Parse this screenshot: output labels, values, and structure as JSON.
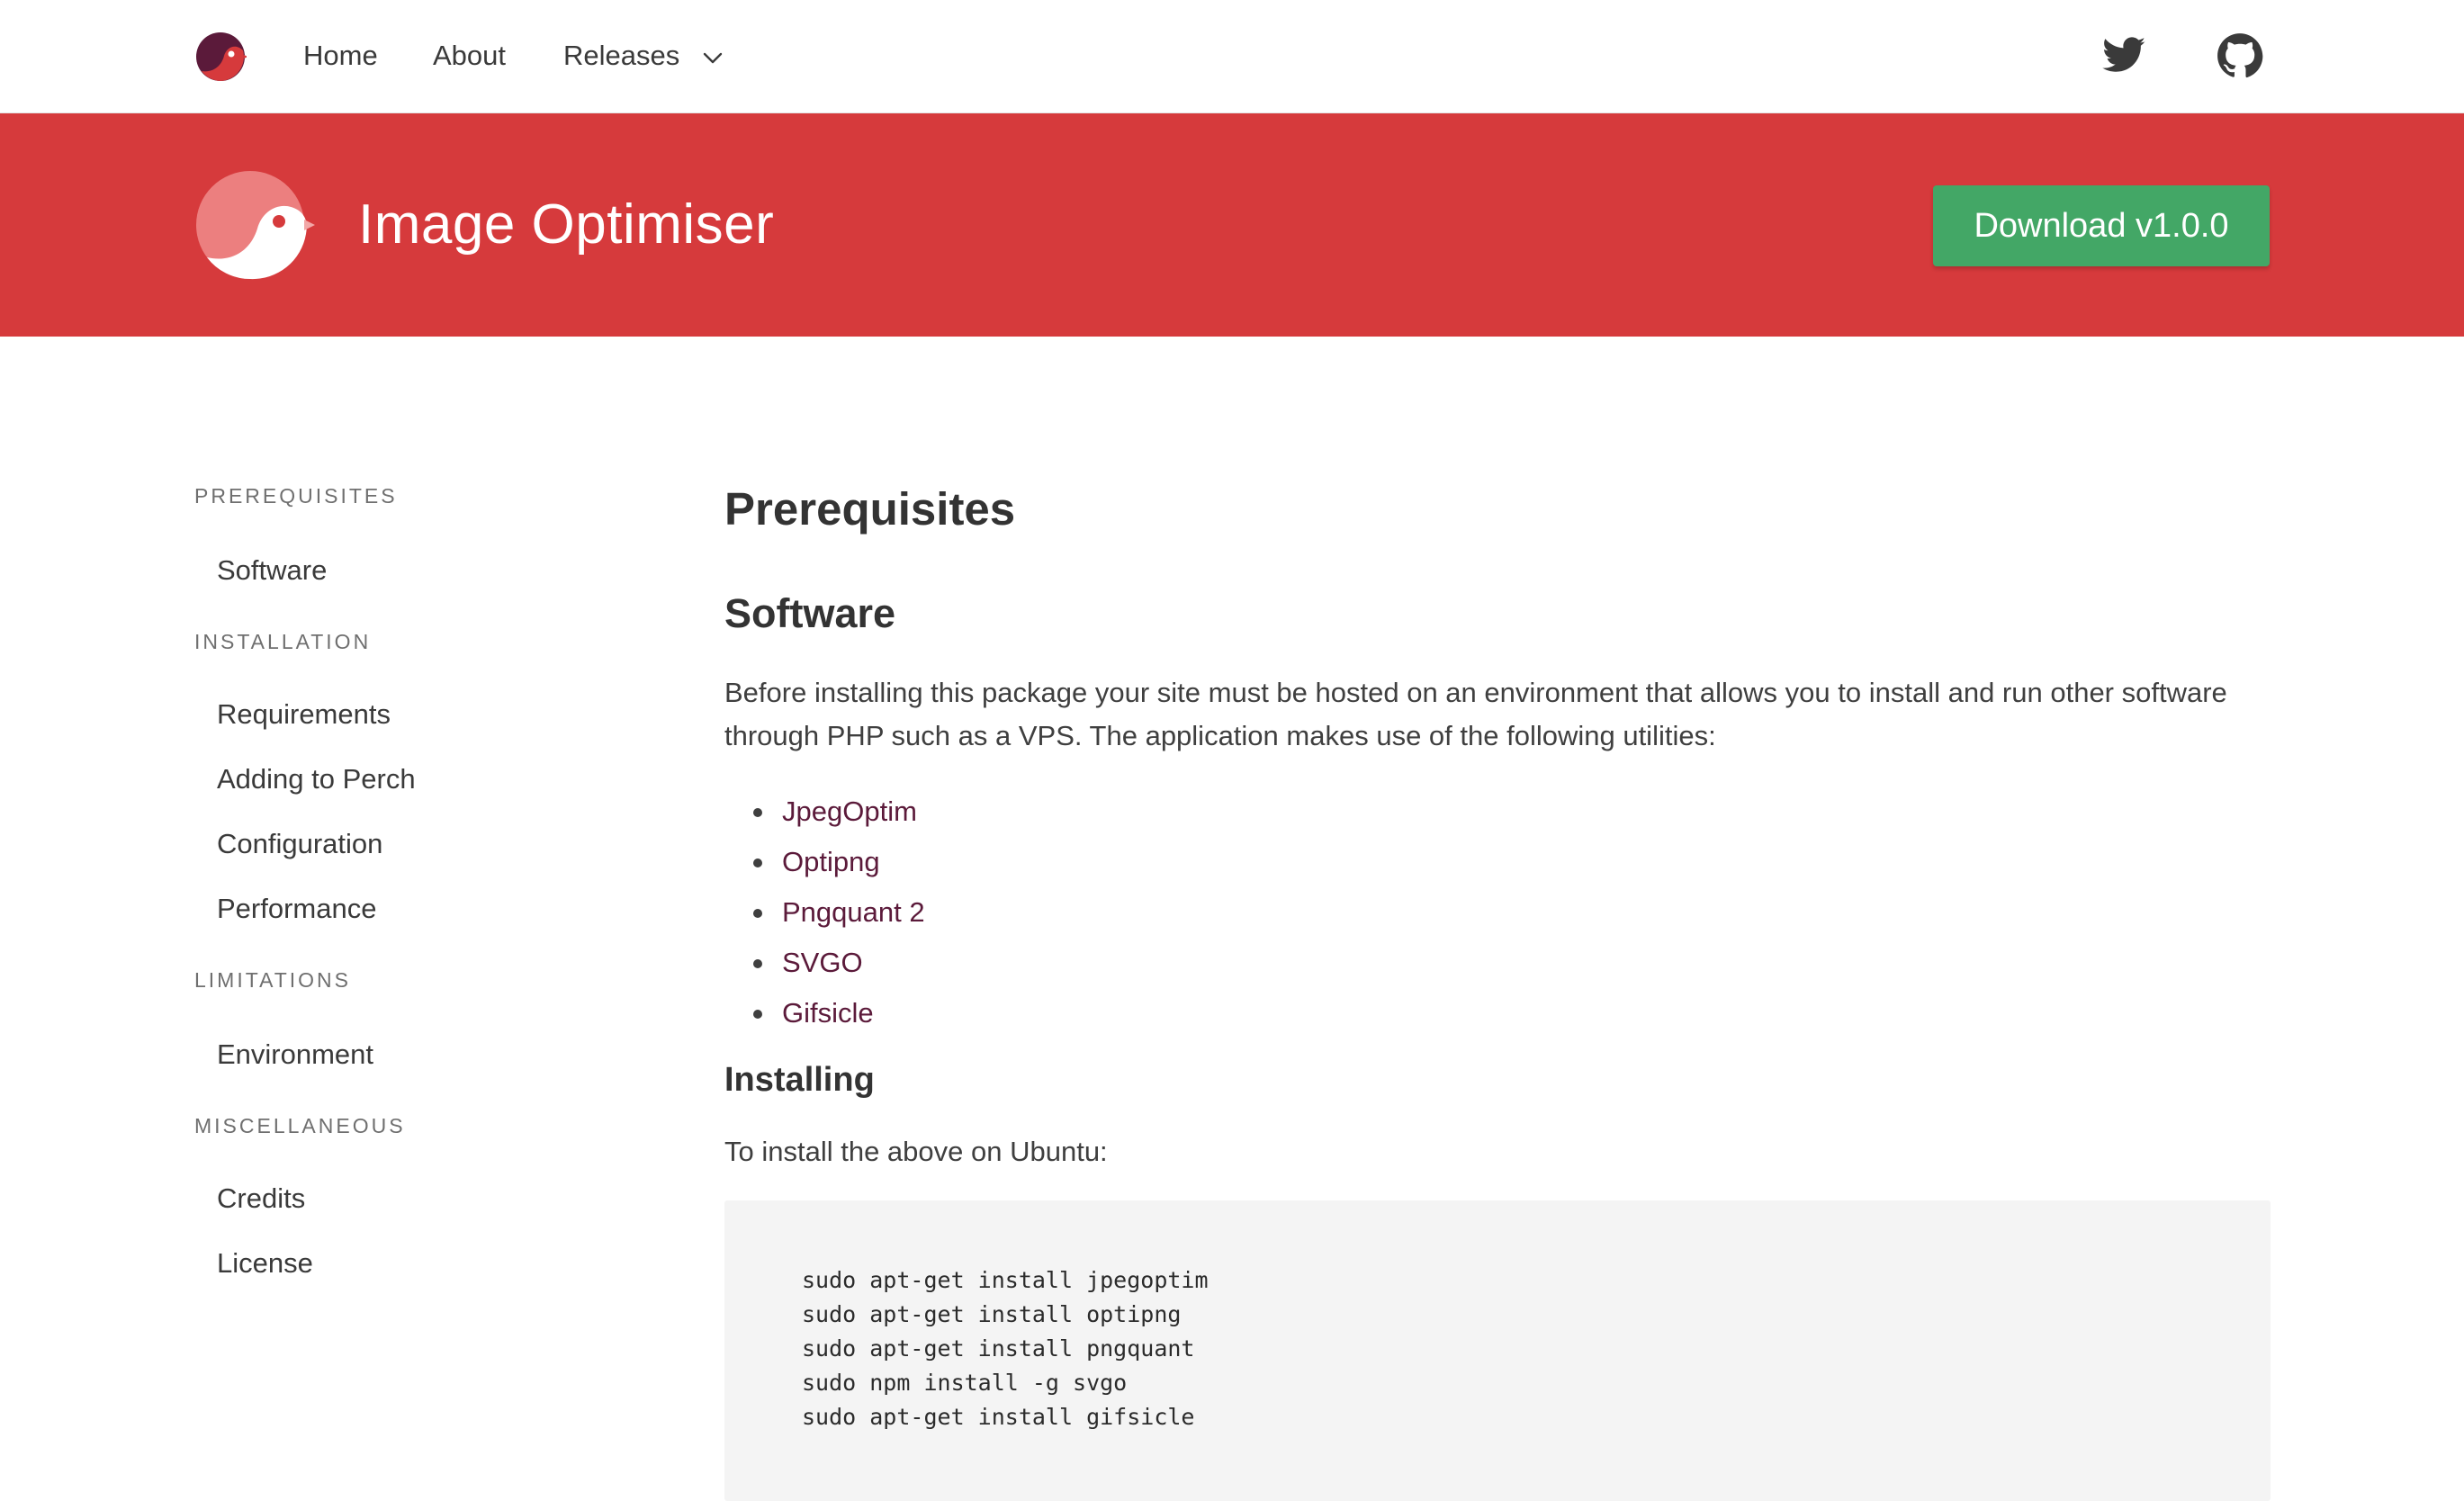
{
  "topnav": {
    "home_label": "Home",
    "about_label": "About",
    "releases_label": "Releases",
    "logo_icon": "bird-logo-icon",
    "chevron_icon": "chevron-down-icon",
    "twitter_icon": "twitter-icon",
    "github_icon": "github-icon"
  },
  "banner": {
    "title": "Image Optimiser",
    "download_label": "Download v1.0.0",
    "background_color": "#d63a3c",
    "button_color": "#43a766"
  },
  "sidebar": {
    "sections": [
      {
        "heading": "PREREQUISITES",
        "items": [
          "Software"
        ]
      },
      {
        "heading": "INSTALLATION",
        "items": [
          "Requirements",
          "Adding to Perch",
          "Configuration",
          "Performance"
        ]
      },
      {
        "heading": "LIMITATIONS",
        "items": [
          "Environment"
        ]
      },
      {
        "heading": "MISCELLANEOUS",
        "items": [
          "Credits",
          "License"
        ]
      }
    ]
  },
  "main": {
    "title": "Prerequisites",
    "software_heading": "Software",
    "software_paragraph": "Before installing this package your site must be hosted on an environment that allows you to install and run other software through PHP such as a VPS. The application makes use of the following utilities:",
    "utilities": [
      "JpegOptim",
      "Optipng",
      "Pngquant 2",
      "SVGO",
      "Gifsicle"
    ],
    "installing_heading": "Installing",
    "installing_paragraph": "To install the above on Ubuntu:",
    "code_lines": [
      "sudo apt-get install jpegoptim",
      "sudo apt-get install optipng",
      "sudo apt-get install pngquant",
      "sudo npm install -g svgo",
      "sudo apt-get install gifsicle"
    ],
    "link_color": "#5b1a3a"
  }
}
